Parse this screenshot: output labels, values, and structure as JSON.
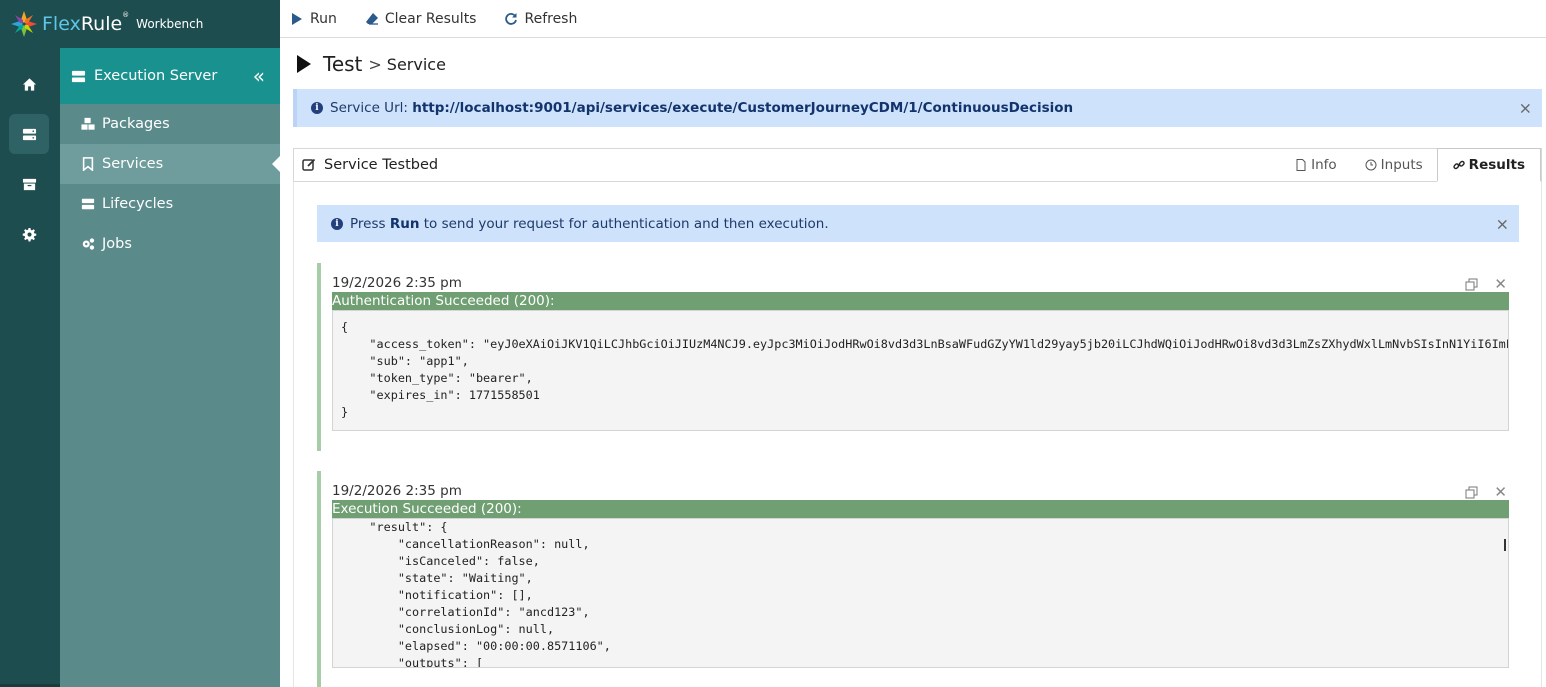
{
  "app": {
    "brand_flex": "Flex",
    "brand_rule": "Rule",
    "brand_reg": "®",
    "product": "Workbench"
  },
  "rail": {
    "items": [
      {
        "icon": "home-icon"
      },
      {
        "icon": "server-icon",
        "active": true
      },
      {
        "icon": "archive-icon"
      },
      {
        "icon": "gear-icon"
      }
    ]
  },
  "sidebar": {
    "title": "Execution Server",
    "collapse_label": "«",
    "items": [
      {
        "label": "Packages",
        "icon": "cubes-icon"
      },
      {
        "label": "Services",
        "icon": "bookmark-icon",
        "active": true
      },
      {
        "label": "Lifecycles",
        "icon": "server-icon"
      },
      {
        "label": "Jobs",
        "icon": "cogs-icon"
      }
    ]
  },
  "toolbar": {
    "run": "Run",
    "clear": "Clear Results",
    "refresh": "Refresh"
  },
  "breadcrumb": {
    "title": "Test",
    "separator": ">",
    "page": "Service"
  },
  "service_url": {
    "label": "Service Url:",
    "url": "http://localhost:9001/api/services/execute/CustomerJourneyCDM/1/ContinuousDecision",
    "close": "×"
  },
  "testbed": {
    "title": "Service Testbed",
    "tabs": [
      {
        "label": "Info",
        "active": false
      },
      {
        "label": "Inputs",
        "active": false
      },
      {
        "label": "Results",
        "active": true
      }
    ]
  },
  "run_hint": {
    "prefix": "Press",
    "bold": "Run",
    "suffix": "to send your request for authentication and then execution.",
    "close": "×"
  },
  "results": [
    {
      "timestamp": "19/2/2026 2:35 pm",
      "status": "Authentication Succeeded (200):",
      "body": "{\n    \"access_token\": \"eyJ0eXAiOiJKV1QiLCJhbGciOiJIUzM4NCJ9.eyJpc3MiOiJodHRwOi8vd3d3LnBsaWFudGZyYW1ld29yay5jb20iLCJhdWQiOiJodHRwOi8vd3d3LmZsZXhydWxlLmNvbSIsInN1YiI6ImF\n    \"sub\": \"app1\",\n    \"token_type\": \"bearer\",\n    \"expires_in\": 1771558501\n}"
    },
    {
      "timestamp": "19/2/2026 2:35 pm",
      "status": "Execution Succeeded (200):",
      "body": "    \"result\": {\n        \"cancellationReason\": null,\n        \"isCanceled\": false,\n        \"state\": \"Waiting\",\n        \"notification\": [],\n        \"correlationId\": \"ancd123\",\n        \"conclusionLog\": null,\n        \"elapsed\": \"00:00:00.8571106\",\n        \"outputs\": ["
    }
  ]
}
